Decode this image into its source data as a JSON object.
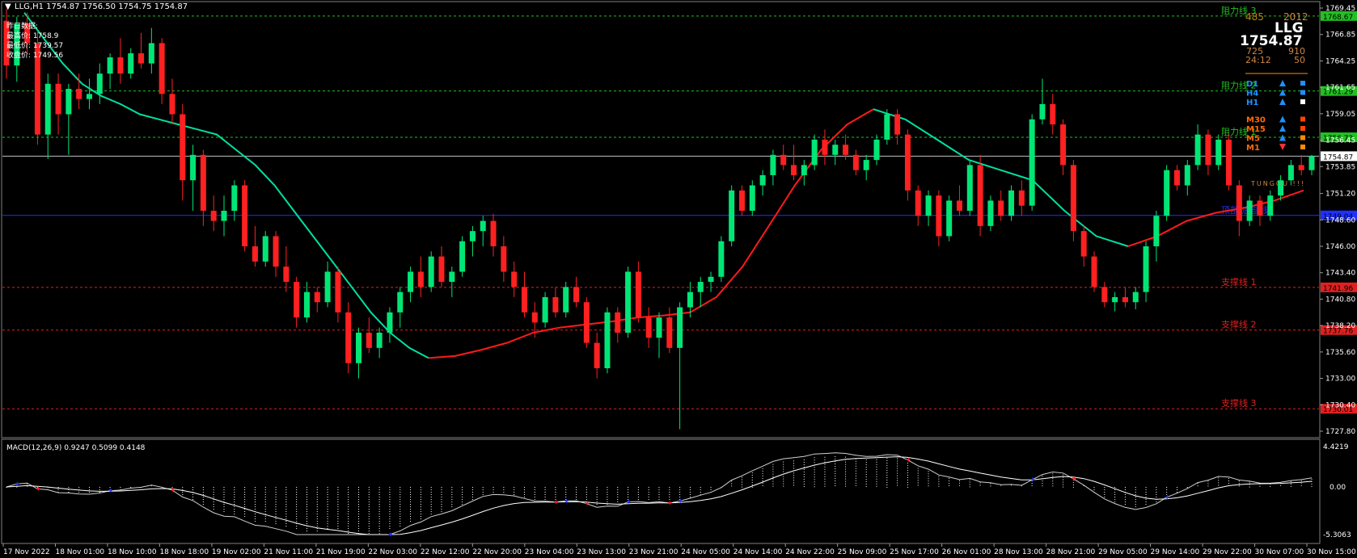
{
  "header": {
    "symbol_line": "LLG,H1  1754.87 1756.50 1754.75 1754.87",
    "prev_day_title": "昨日数据:",
    "prev_high": "最高价: 1758.9",
    "prev_low": "最低价: 1739.57",
    "prev_close": "收盘价: 1749.56"
  },
  "info_panel": {
    "num_left": "485",
    "num_right": "2012",
    "symbol": "LLG",
    "price": "1754.87",
    "stat_a": "725",
    "stat_b": "910",
    "countdown": "24:12",
    "stat_c": "50",
    "watermark": "TUNGGU !!!",
    "timeframes": [
      {
        "label": "D1",
        "color": "#1e90ff",
        "arrow": "up",
        "arrow_color": "#1e90ff",
        "square_color": "#1e90ff"
      },
      {
        "label": "H4",
        "color": "#1e90ff",
        "arrow": "up",
        "arrow_color": "#1e90ff",
        "square_color": "#1e90ff"
      },
      {
        "label": "H1",
        "color": "#1e90ff",
        "arrow": "up",
        "arrow_color": "#1e90ff",
        "square_color": "#ffffff"
      },
      {
        "label": "M30",
        "color": "#ff6a00",
        "arrow": "up",
        "arrow_color": "#1e90ff",
        "square_color": "#ff4500"
      },
      {
        "label": "M15",
        "color": "#ff6a00",
        "arrow": "up",
        "arrow_color": "#1e90ff",
        "square_color": "#ff4500"
      },
      {
        "label": "M5",
        "color": "#ff6a00",
        "arrow": "up",
        "arrow_color": "#1e90ff",
        "square_color": "#ff8c00"
      },
      {
        "label": "M1",
        "color": "#ff6a00",
        "arrow": "down",
        "arrow_color": "#ff3030",
        "square_color": "#ff8c00"
      }
    ]
  },
  "levels": [
    {
      "label": "阻力线 3",
      "value": "1768.67",
      "color": "#22c022",
      "style": "dash"
    },
    {
      "label": "阻力线 2",
      "value": "1761.29",
      "color": "#22c022",
      "style": "dash"
    },
    {
      "label": "阻力线 1",
      "value": "1756.73",
      "color": "#22c022",
      "style": "dash"
    },
    {
      "label": "",
      "value": "1754.87",
      "color": "#c0c0c0",
      "style": "solid",
      "current": true
    },
    {
      "label": "顶部/底部线",
      "value": "1749.04",
      "color": "#2030ff",
      "style": "solid"
    },
    {
      "label": "支撑线 1",
      "value": "1741.96",
      "color": "#e02020",
      "style": "dash"
    },
    {
      "label": "支撑线 2",
      "value": "1737.76",
      "color": "#e02020",
      "style": "dash"
    },
    {
      "label": "支撑线 3",
      "value": "1730.01",
      "color": "#e02020",
      "style": "dash"
    }
  ],
  "price_axis_ticks": [
    "1769.45",
    "1766.85",
    "1764.25",
    "1761.65",
    "1759.05",
    "1756.45",
    "1753.85",
    "1751.20",
    "1748.60",
    "1746.00",
    "1743.40",
    "1740.80",
    "1738.20",
    "1735.60",
    "1733.00",
    "1730.40",
    "1727.80"
  ],
  "time_axis": [
    "17 Nov 2022",
    "18 Nov 01:00",
    "18 Nov 10:00",
    "18 Nov 18:00",
    "19 Nov 02:00",
    "21 Nov 11:00",
    "21 Nov 19:00",
    "22 Nov 03:00",
    "22 Nov 12:00",
    "22 Nov 20:00",
    "23 Nov 04:00",
    "23 Nov 13:00",
    "23 Nov 21:00",
    "24 Nov 05:00",
    "24 Nov 14:00",
    "24 Nov 22:00",
    "25 Nov 09:00",
    "25 Nov 17:00",
    "26 Nov 01:00",
    "28 Nov 13:00",
    "28 Nov 21:00",
    "29 Nov 05:00",
    "29 Nov 14:00",
    "29 Nov 22:00",
    "30 Nov 07:00",
    "30 Nov 15:00"
  ],
  "macd": {
    "title": "MACD(12,26,9) 0.9247 0.5099 0.4148",
    "axis_top": "4.4219",
    "axis_zero": "0.00",
    "axis_bottom": "-5.3063"
  },
  "chart_data": {
    "type": "candlestick",
    "symbol": "LLG",
    "timeframe": "H1",
    "ylim": [
      1727.8,
      1769.45
    ],
    "up_color": "#00e676",
    "down_color": "#ff2020",
    "candles": [
      {
        "o": 1768.2,
        "h": 1769.4,
        "l": 1762.5,
        "c": 1763.8
      },
      {
        "o": 1763.8,
        "h": 1768.6,
        "l": 1762.2,
        "c": 1767.9
      },
      {
        "o": 1767.9,
        "h": 1769.0,
        "l": 1765.0,
        "c": 1766.0
      },
      {
        "o": 1766.0,
        "h": 1767.2,
        "l": 1756.0,
        "c": 1757.0
      },
      {
        "o": 1757.0,
        "h": 1763.0,
        "l": 1754.6,
        "c": 1762.0
      },
      {
        "o": 1762.0,
        "h": 1763.0,
        "l": 1757.0,
        "c": 1759.0
      },
      {
        "o": 1759.0,
        "h": 1762.0,
        "l": 1755.0,
        "c": 1761.5
      },
      {
        "o": 1761.5,
        "h": 1763.0,
        "l": 1759.5,
        "c": 1760.5
      },
      {
        "o": 1760.5,
        "h": 1762.5,
        "l": 1759.5,
        "c": 1761.0
      },
      {
        "o": 1761.0,
        "h": 1764.0,
        "l": 1760.0,
        "c": 1763.0
      },
      {
        "o": 1763.0,
        "h": 1765.0,
        "l": 1761.5,
        "c": 1764.6
      },
      {
        "o": 1764.6,
        "h": 1766.5,
        "l": 1762.0,
        "c": 1763.0
      },
      {
        "o": 1763.0,
        "h": 1765.5,
        "l": 1762.5,
        "c": 1765.0
      },
      {
        "o": 1765.0,
        "h": 1767.0,
        "l": 1763.5,
        "c": 1764.0
      },
      {
        "o": 1764.0,
        "h": 1767.5,
        "l": 1763.0,
        "c": 1766.0
      },
      {
        "o": 1766.0,
        "h": 1766.5,
        "l": 1760.0,
        "c": 1761.0
      },
      {
        "o": 1761.0,
        "h": 1762.5,
        "l": 1758.0,
        "c": 1759.0
      },
      {
        "o": 1759.0,
        "h": 1760.0,
        "l": 1750.5,
        "c": 1752.5
      },
      {
        "o": 1752.5,
        "h": 1756.0,
        "l": 1749.5,
        "c": 1755.0
      },
      {
        "o": 1755.0,
        "h": 1755.5,
        "l": 1748.0,
        "c": 1749.5
      },
      {
        "o": 1749.5,
        "h": 1751.0,
        "l": 1747.5,
        "c": 1748.5
      },
      {
        "o": 1748.5,
        "h": 1751.0,
        "l": 1747.0,
        "c": 1749.5
      },
      {
        "o": 1749.5,
        "h": 1752.5,
        "l": 1748.5,
        "c": 1752.0
      },
      {
        "o": 1752.0,
        "h": 1752.5,
        "l": 1745.5,
        "c": 1746.0
      },
      {
        "o": 1746.0,
        "h": 1748.0,
        "l": 1744.0,
        "c": 1744.5
      },
      {
        "o": 1744.5,
        "h": 1747.5,
        "l": 1744.0,
        "c": 1747.0
      },
      {
        "o": 1747.0,
        "h": 1747.5,
        "l": 1743.0,
        "c": 1744.0
      },
      {
        "o": 1744.0,
        "h": 1746.0,
        "l": 1741.5,
        "c": 1742.5
      },
      {
        "o": 1742.5,
        "h": 1743.0,
        "l": 1738.0,
        "c": 1739.0
      },
      {
        "o": 1739.0,
        "h": 1742.5,
        "l": 1738.5,
        "c": 1741.5
      },
      {
        "o": 1741.5,
        "h": 1742.0,
        "l": 1739.5,
        "c": 1740.5
      },
      {
        "o": 1740.5,
        "h": 1744.5,
        "l": 1740.0,
        "c": 1743.5
      },
      {
        "o": 1743.5,
        "h": 1744.0,
        "l": 1738.5,
        "c": 1739.5
      },
      {
        "o": 1739.5,
        "h": 1740.5,
        "l": 1733.5,
        "c": 1734.5
      },
      {
        "o": 1734.5,
        "h": 1738.0,
        "l": 1733.0,
        "c": 1737.5
      },
      {
        "o": 1737.5,
        "h": 1739.0,
        "l": 1735.5,
        "c": 1736.0
      },
      {
        "o": 1736.0,
        "h": 1738.0,
        "l": 1735.0,
        "c": 1737.5
      },
      {
        "o": 1737.5,
        "h": 1740.0,
        "l": 1736.5,
        "c": 1739.5
      },
      {
        "o": 1739.5,
        "h": 1742.0,
        "l": 1738.0,
        "c": 1741.5
      },
      {
        "o": 1741.5,
        "h": 1744.0,
        "l": 1740.5,
        "c": 1743.5
      },
      {
        "o": 1743.5,
        "h": 1745.0,
        "l": 1741.0,
        "c": 1742.0
      },
      {
        "o": 1742.0,
        "h": 1745.5,
        "l": 1741.5,
        "c": 1745.0
      },
      {
        "o": 1745.0,
        "h": 1746.0,
        "l": 1742.0,
        "c": 1742.5
      },
      {
        "o": 1742.5,
        "h": 1744.0,
        "l": 1741.0,
        "c": 1743.5
      },
      {
        "o": 1743.5,
        "h": 1747.0,
        "l": 1743.0,
        "c": 1746.5
      },
      {
        "o": 1746.5,
        "h": 1748.0,
        "l": 1745.0,
        "c": 1747.5
      },
      {
        "o": 1747.5,
        "h": 1749.0,
        "l": 1746.0,
        "c": 1748.5
      },
      {
        "o": 1748.5,
        "h": 1749.2,
        "l": 1745.0,
        "c": 1746.0
      },
      {
        "o": 1746.0,
        "h": 1747.0,
        "l": 1742.5,
        "c": 1743.5
      },
      {
        "o": 1743.5,
        "h": 1744.5,
        "l": 1741.0,
        "c": 1742.0
      },
      {
        "o": 1742.0,
        "h": 1743.5,
        "l": 1739.0,
        "c": 1739.5
      },
      {
        "o": 1739.5,
        "h": 1740.5,
        "l": 1737.0,
        "c": 1738.5
      },
      {
        "o": 1738.5,
        "h": 1741.5,
        "l": 1738.0,
        "c": 1741.0
      },
      {
        "o": 1741.0,
        "h": 1742.0,
        "l": 1739.0,
        "c": 1739.5
      },
      {
        "o": 1739.5,
        "h": 1742.5,
        "l": 1739.0,
        "c": 1742.0
      },
      {
        "o": 1742.0,
        "h": 1743.0,
        "l": 1740.0,
        "c": 1740.5
      },
      {
        "o": 1740.5,
        "h": 1741.0,
        "l": 1736.0,
        "c": 1736.5
      },
      {
        "o": 1736.5,
        "h": 1737.5,
        "l": 1733.0,
        "c": 1734.0
      },
      {
        "o": 1734.0,
        "h": 1740.0,
        "l": 1733.5,
        "c": 1739.5
      },
      {
        "o": 1739.5,
        "h": 1740.0,
        "l": 1736.5,
        "c": 1737.5
      },
      {
        "o": 1737.5,
        "h": 1744.0,
        "l": 1737.0,
        "c": 1743.5
      },
      {
        "o": 1743.5,
        "h": 1744.5,
        "l": 1738.5,
        "c": 1739.0
      },
      {
        "o": 1739.0,
        "h": 1740.0,
        "l": 1736.0,
        "c": 1737.0
      },
      {
        "o": 1737.0,
        "h": 1739.5,
        "l": 1735.0,
        "c": 1739.0
      },
      {
        "o": 1739.0,
        "h": 1740.0,
        "l": 1735.5,
        "c": 1736.0
      },
      {
        "o": 1736.0,
        "h": 1740.5,
        "l": 1728.0,
        "c": 1740.0
      },
      {
        "o": 1740.0,
        "h": 1742.5,
        "l": 1739.0,
        "c": 1741.5
      },
      {
        "o": 1741.5,
        "h": 1743.0,
        "l": 1740.0,
        "c": 1742.5
      },
      {
        "o": 1742.5,
        "h": 1743.5,
        "l": 1741.5,
        "c": 1743.0
      },
      {
        "o": 1743.0,
        "h": 1747.0,
        "l": 1742.5,
        "c": 1746.5
      },
      {
        "o": 1746.5,
        "h": 1752.0,
        "l": 1746.0,
        "c": 1751.5
      },
      {
        "o": 1751.5,
        "h": 1752.0,
        "l": 1749.0,
        "c": 1749.5
      },
      {
        "o": 1749.5,
        "h": 1752.5,
        "l": 1749.0,
        "c": 1752.0
      },
      {
        "o": 1752.0,
        "h": 1753.5,
        "l": 1751.0,
        "c": 1753.0
      },
      {
        "o": 1753.0,
        "h": 1755.5,
        "l": 1752.0,
        "c": 1755.0
      },
      {
        "o": 1755.0,
        "h": 1756.0,
        "l": 1753.5,
        "c": 1754.0
      },
      {
        "o": 1754.0,
        "h": 1756.0,
        "l": 1752.5,
        "c": 1753.0
      },
      {
        "o": 1753.0,
        "h": 1754.5,
        "l": 1752.0,
        "c": 1754.0
      },
      {
        "o": 1754.0,
        "h": 1757.0,
        "l": 1753.5,
        "c": 1756.5
      },
      {
        "o": 1756.5,
        "h": 1757.5,
        "l": 1754.0,
        "c": 1755.0
      },
      {
        "o": 1755.0,
        "h": 1756.5,
        "l": 1754.0,
        "c": 1756.0
      },
      {
        "o": 1756.0,
        "h": 1757.0,
        "l": 1754.5,
        "c": 1755.0
      },
      {
        "o": 1755.0,
        "h": 1755.5,
        "l": 1753.0,
        "c": 1753.5
      },
      {
        "o": 1753.5,
        "h": 1755.0,
        "l": 1752.5,
        "c": 1754.5
      },
      {
        "o": 1754.5,
        "h": 1757.0,
        "l": 1754.0,
        "c": 1756.5
      },
      {
        "o": 1756.5,
        "h": 1759.5,
        "l": 1756.0,
        "c": 1759.0
      },
      {
        "o": 1759.0,
        "h": 1759.5,
        "l": 1756.0,
        "c": 1757.0
      },
      {
        "o": 1757.0,
        "h": 1757.5,
        "l": 1750.5,
        "c": 1751.5
      },
      {
        "o": 1751.5,
        "h": 1752.0,
        "l": 1748.0,
        "c": 1749.0
      },
      {
        "o": 1749.0,
        "h": 1751.5,
        "l": 1748.0,
        "c": 1751.0
      },
      {
        "o": 1751.0,
        "h": 1751.5,
        "l": 1746.0,
        "c": 1747.0
      },
      {
        "o": 1747.0,
        "h": 1751.0,
        "l": 1746.5,
        "c": 1750.5
      },
      {
        "o": 1750.5,
        "h": 1752.0,
        "l": 1749.0,
        "c": 1749.5
      },
      {
        "o": 1749.5,
        "h": 1754.5,
        "l": 1749.0,
        "c": 1754.0
      },
      {
        "o": 1754.0,
        "h": 1755.0,
        "l": 1747.0,
        "c": 1748.0
      },
      {
        "o": 1748.0,
        "h": 1751.0,
        "l": 1747.5,
        "c": 1750.5
      },
      {
        "o": 1750.5,
        "h": 1751.5,
        "l": 1748.5,
        "c": 1749.0
      },
      {
        "o": 1749.0,
        "h": 1752.0,
        "l": 1748.5,
        "c": 1751.5
      },
      {
        "o": 1751.5,
        "h": 1752.5,
        "l": 1749.0,
        "c": 1750.0
      },
      {
        "o": 1750.0,
        "h": 1759.0,
        "l": 1749.5,
        "c": 1758.5
      },
      {
        "o": 1758.5,
        "h": 1762.5,
        "l": 1758.0,
        "c": 1760.0
      },
      {
        "o": 1760.0,
        "h": 1761.0,
        "l": 1757.0,
        "c": 1758.0
      },
      {
        "o": 1758.0,
        "h": 1758.5,
        "l": 1753.0,
        "c": 1754.0
      },
      {
        "o": 1754.0,
        "h": 1754.5,
        "l": 1746.5,
        "c": 1747.5
      },
      {
        "o": 1747.5,
        "h": 1748.0,
        "l": 1744.0,
        "c": 1745.0
      },
      {
        "o": 1745.0,
        "h": 1745.5,
        "l": 1741.5,
        "c": 1742.0
      },
      {
        "o": 1742.0,
        "h": 1742.5,
        "l": 1740.0,
        "c": 1740.5
      },
      {
        "o": 1740.5,
        "h": 1741.5,
        "l": 1739.6,
        "c": 1741.0
      },
      {
        "o": 1741.0,
        "h": 1742.0,
        "l": 1740.0,
        "c": 1740.5
      },
      {
        "o": 1740.5,
        "h": 1742.0,
        "l": 1739.8,
        "c": 1741.5
      },
      {
        "o": 1741.5,
        "h": 1746.5,
        "l": 1740.5,
        "c": 1746.0
      },
      {
        "o": 1746.0,
        "h": 1749.5,
        "l": 1744.5,
        "c": 1749.0
      },
      {
        "o": 1749.0,
        "h": 1754.0,
        "l": 1748.5,
        "c": 1753.5
      },
      {
        "o": 1753.5,
        "h": 1754.0,
        "l": 1751.5,
        "c": 1752.0
      },
      {
        "o": 1752.0,
        "h": 1754.5,
        "l": 1751.0,
        "c": 1754.0
      },
      {
        "o": 1754.0,
        "h": 1758.0,
        "l": 1753.5,
        "c": 1757.0
      },
      {
        "o": 1757.0,
        "h": 1757.5,
        "l": 1753.0,
        "c": 1754.0
      },
      {
        "o": 1754.0,
        "h": 1757.0,
        "l": 1753.5,
        "c": 1756.5
      },
      {
        "o": 1756.5,
        "h": 1757.0,
        "l": 1751.5,
        "c": 1752.0
      },
      {
        "o": 1752.0,
        "h": 1752.5,
        "l": 1747.0,
        "c": 1748.5
      },
      {
        "o": 1748.5,
        "h": 1751.0,
        "l": 1748.0,
        "c": 1750.5
      },
      {
        "o": 1750.5,
        "h": 1751.0,
        "l": 1748.0,
        "c": 1749.0
      },
      {
        "o": 1749.0,
        "h": 1751.5,
        "l": 1748.5,
        "c": 1751.0
      },
      {
        "o": 1751.0,
        "h": 1753.0,
        "l": 1750.5,
        "c": 1752.5
      },
      {
        "o": 1752.5,
        "h": 1754.5,
        "l": 1752.0,
        "c": 1754.0
      },
      {
        "o": 1754.0,
        "h": 1755.0,
        "l": 1753.0,
        "c": 1753.5
      },
      {
        "o": 1753.5,
        "h": 1755.0,
        "l": 1753.0,
        "c": 1754.87
      }
    ],
    "ma_green": [
      1769.0,
      1766.5,
      1764.0,
      1762.0,
      1760.8,
      1760.0,
      1759.0,
      1758.5,
      1758.0,
      1757.5,
      1757.0,
      1755.5,
      1754.0,
      1752.0,
      1749.5,
      1747.0,
      1744.5,
      1742.0,
      1739.5,
      1737.5,
      1736.0,
      1735.0
    ],
    "ma_red": [
      1735.0,
      1735.2,
      1735.8,
      1736.5,
      1737.5,
      1738.0,
      1738.3,
      1738.6,
      1739.0,
      1739.2,
      1739.5,
      1741.0,
      1744.0,
      1748.0,
      1752.0,
      1755.5,
      1758.0,
      1759.5
    ],
    "ma_tail_green": [
      1759.5,
      1758.5,
      1756.5,
      1754.5,
      1753.5,
      1752.5,
      1749.5,
      1747.0,
      1746.0
    ],
    "ma_tail_red": [
      1746.0,
      1747.0,
      1748.5,
      1749.3,
      1749.8,
      1750.5,
      1751.5
    ]
  }
}
